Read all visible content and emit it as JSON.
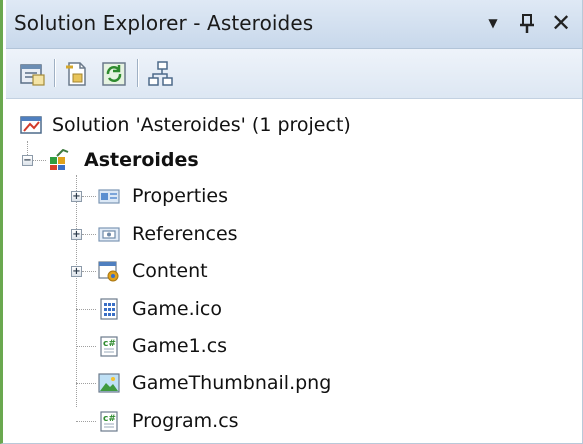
{
  "window": {
    "title": "Solution Explorer - Asteroides",
    "buttons": {
      "dropdown": "▼",
      "pin": "ꟷ",
      "close": "✕"
    }
  },
  "toolbar": {
    "items": [
      "properties-icon",
      "show-all-files-icon",
      "refresh-icon",
      "class-diagram-icon"
    ]
  },
  "tree": {
    "solution": "Solution 'Asteroides' (1 project)",
    "project": "Asteroides",
    "items": [
      {
        "label": "Properties",
        "icon": "properties-folder-icon",
        "expandable": true
      },
      {
        "label": "References",
        "icon": "references-folder-icon",
        "expandable": true
      },
      {
        "label": "Content",
        "icon": "content-project-icon",
        "expandable": true
      },
      {
        "label": "Game.ico",
        "icon": "ico-file-icon",
        "expandable": false
      },
      {
        "label": "Game1.cs",
        "icon": "csharp-file-icon",
        "expandable": false
      },
      {
        "label": "GameThumbnail.png",
        "icon": "image-file-icon",
        "expandable": false
      },
      {
        "label": "Program.cs",
        "icon": "csharp-file-icon",
        "expandable": false
      }
    ],
    "expanders": {
      "collapse": "−",
      "expand": "+"
    }
  }
}
